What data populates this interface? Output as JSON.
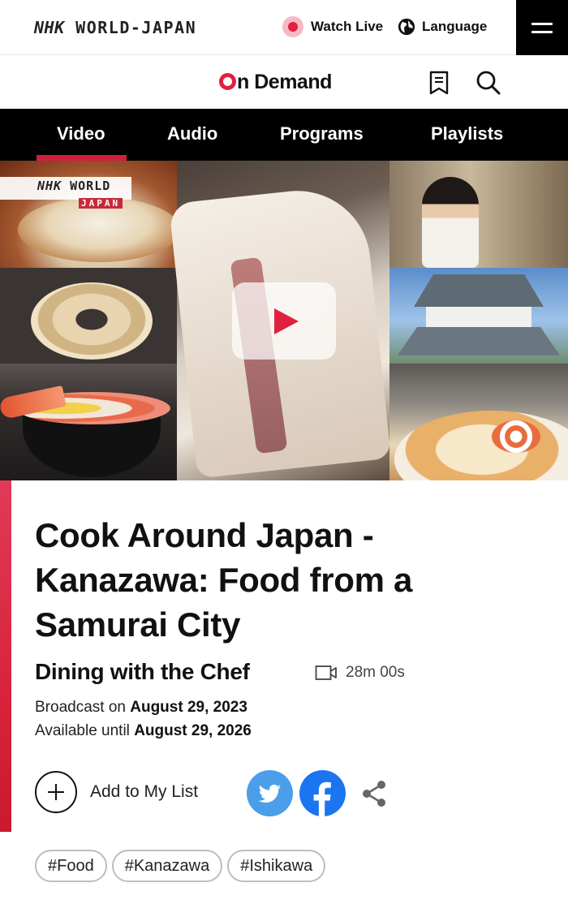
{
  "header": {
    "logo_brand": "NHK",
    "logo_text": "WORLD-JAPAN",
    "watch_live_label": "Watch Live",
    "language_label": "Language"
  },
  "ondemand": {
    "logo_letter": "n",
    "logo_rest": "Demand"
  },
  "nav": {
    "tabs": [
      {
        "label": "Video",
        "active": true
      },
      {
        "label": "Audio",
        "active": false
      },
      {
        "label": "Programs",
        "active": false
      },
      {
        "label": "Playlists",
        "active": false
      }
    ]
  },
  "hero": {
    "badge_brand": "NHK",
    "badge_text": "WORLD",
    "badge_sub": "JAPAN"
  },
  "episode": {
    "title": "Cook Around Japan - Kanazawa: Food from a Samurai City",
    "program": "Dining with the Chef",
    "duration": "28m 00s",
    "broadcast_prefix": "Broadcast on",
    "broadcast_date": "August 29, 2023",
    "available_prefix": "Available until",
    "available_date": "August 29, 2026",
    "add_to_list_label": "Add to My List"
  },
  "tags": [
    "#Food",
    "#Kanazawa",
    "#Ishikawa"
  ],
  "colors": {
    "accent_red": "#e0203f",
    "twitter_blue": "#4a9eea",
    "facebook_blue": "#1b75f0",
    "nav_bg": "#000000"
  },
  "icons": [
    "globe-icon",
    "menu-icon",
    "bookmark-icon",
    "search-icon",
    "play-icon",
    "video-camera-icon",
    "plus-icon",
    "twitter-icon",
    "facebook-icon",
    "share-icon"
  ]
}
